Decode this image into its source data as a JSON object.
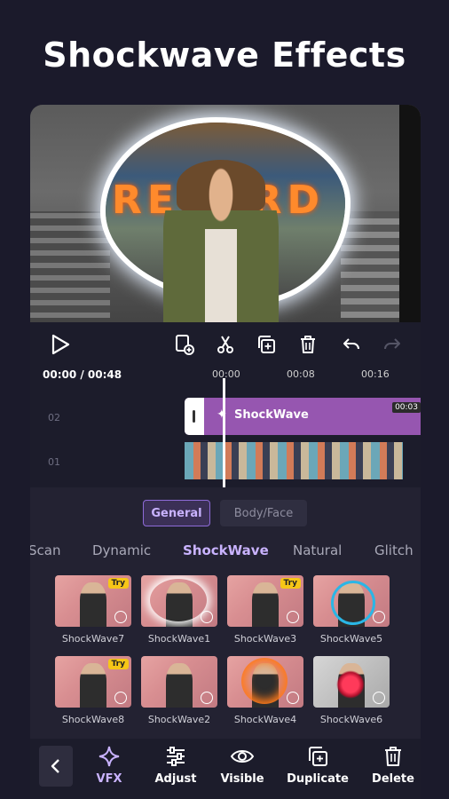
{
  "headline": "Shockwave Effects",
  "preview": {
    "sign_text": "RECORD"
  },
  "player": {
    "current_time": "00:00 / 00:48",
    "ticks": [
      "00:00",
      "00:08",
      "00:16"
    ]
  },
  "timeline": {
    "track_numbers": [
      "02",
      "01"
    ],
    "effect_clip_label": "ShockWave",
    "effect_clip_duration": "00:03"
  },
  "segments": [
    {
      "label": "General",
      "active": true
    },
    {
      "label": "Body/Face",
      "active": false
    }
  ],
  "categories": [
    "Scan",
    "Dynamic",
    "ShockWave",
    "Natural",
    "Glitch"
  ],
  "active_category": "ShockWave",
  "effects": [
    {
      "name": "ShockWave7",
      "try": true
    },
    {
      "name": "ShockWave1",
      "try": false
    },
    {
      "name": "ShockWave3",
      "try": true
    },
    {
      "name": "ShockWave5",
      "try": false
    },
    {
      "name": "ShockWave8",
      "try": true
    },
    {
      "name": "ShockWave2",
      "try": false
    },
    {
      "name": "ShockWave4",
      "try": false
    },
    {
      "name": "ShockWave6",
      "try": false
    }
  ],
  "try_badge": "Try",
  "toolbar": {
    "items": [
      {
        "label": "VFX",
        "icon": "sparkle-icon",
        "active": true
      },
      {
        "label": "Adjust",
        "icon": "sliders-icon",
        "active": false
      },
      {
        "label": "Visible",
        "icon": "eye-icon",
        "active": false
      },
      {
        "label": "Duplicate",
        "icon": "duplicate-icon",
        "active": false
      },
      {
        "label": "Delete",
        "icon": "trash-icon",
        "active": false
      }
    ]
  },
  "colors": {
    "accent": "#c9b3ff",
    "clip": "#9656b0",
    "try_badge": "#f6c617",
    "background": "#1b1a2b"
  }
}
